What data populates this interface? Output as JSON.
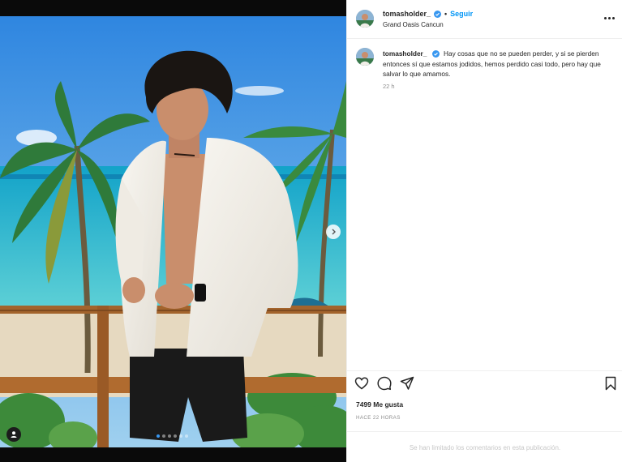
{
  "post": {
    "username": "tomasholder_",
    "follow_label": "Seguir",
    "separator": "•",
    "location": "Grand Oasis Cancun"
  },
  "caption": {
    "username": "tomasholder_",
    "text": "Hay cosas que no se pueden perder, y si se pierden entonces sí que estamos jodidos, hemos perdido casi todo, pero hay que salvar lo que amamos.",
    "time": "22 h"
  },
  "actions": {
    "like_icon": "heart-icon",
    "comment_icon": "comment-icon",
    "share_icon": "paper-plane-icon",
    "save_icon": "bookmark-icon"
  },
  "stats": {
    "likes": "7499 Me gusta",
    "posted_ago": "HACE 22 HORAS"
  },
  "comments": {
    "limited_notice": "Se han limitado los comentarios en esta publicación."
  },
  "carousel": {
    "slide_count": 6,
    "active_index": 0
  },
  "colors": {
    "accent": "#0095f6",
    "verified": "#3897f0",
    "muted": "#8e8e8e"
  }
}
